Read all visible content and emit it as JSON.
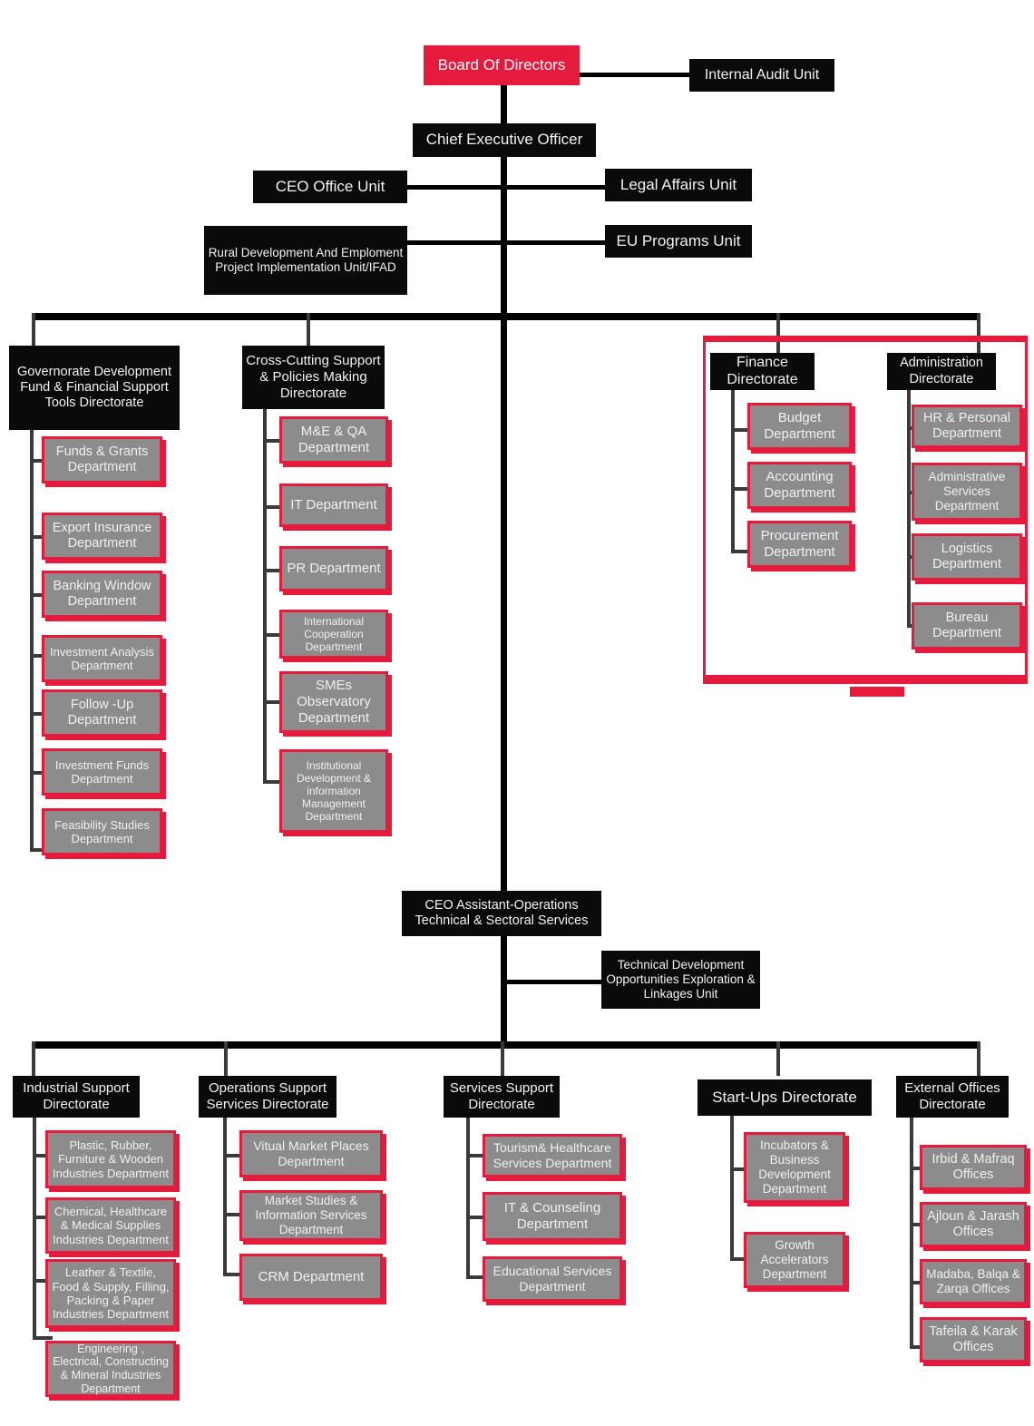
{
  "title": "Organizational Structure Chart",
  "colors": {
    "red": "#e51a3c",
    "black": "#0a0a0a",
    "gray": "#8c8c8c",
    "line": "#000000"
  },
  "top": {
    "board": "Board Of Directors",
    "internal_audit": "Internal Audit Unit",
    "ceo": "Chief Executive Officer",
    "ceo_office": "CEO Office Unit",
    "legal_affairs": "Legal Affairs Unit",
    "rural_dev": "Rural Development And Emploment Project Implementation Unit/IFAD",
    "eu_programs": "EU Programs Unit"
  },
  "directorates_upper": [
    {
      "name": "Governorate Development Fund & Financial Support Tools Directorate",
      "departments": [
        "Funds & Grants Department",
        "Export Insurance Department",
        "Banking Window Department",
        "Investment Analysis Department",
        "Follow -Up Department",
        "Investment Funds Department",
        "Feasibility Studies Department"
      ]
    },
    {
      "name": "Cross-Cutting Support & Policies Making Directorate",
      "departments": [
        "M&E & QA Department",
        "IT Department",
        "PR Department",
        "International Cooperation Department",
        "SMEs Observatory Department",
        "Institutional Development & information Management Department"
      ]
    },
    {
      "name": "Finance Directorate",
      "departments": [
        "Budget Department",
        "Accounting Department",
        "Procurement Department"
      ]
    },
    {
      "name": "Administration Directorate",
      "departments": [
        "HR & Personal Department",
        "Administrative Services Department",
        "Logistics Department",
        "Bureau Department"
      ]
    }
  ],
  "middle": {
    "ceo_assistant": "CEO Assistant-Operations Technical & Sectoral Services",
    "tech_dev_unit": "Technical Development Opportunities Exploration & Linkages Unit"
  },
  "directorates_lower": [
    {
      "name": "Industrial Support Directorate",
      "departments": [
        "Plastic, Rubber, Furniture & Wooden Industries Department",
        "Chemical, Healthcare & Medical Supplies Industries Department",
        "Leather & Textile, Food & Supply, Filling, Packing & Paper Industries Department",
        "Engineering , Electrical, Constructing & Mineral Industries Department"
      ]
    },
    {
      "name": "Operations Support Services Directorate",
      "departments": [
        "Vitual Market Places Department",
        "Market Studies & Information Services Department",
        "CRM Department"
      ]
    },
    {
      "name": "Services Support Directorate",
      "departments": [
        "Tourism& Healthcare Services Department",
        "IT & Counseling Department",
        "Educational Services Department"
      ]
    },
    {
      "name": "Start-Ups Directorate",
      "departments": [
        "Incubators & Business Development Department",
        "Growth Accelerators Department"
      ]
    },
    {
      "name": "External Offices Directorate",
      "departments": [
        "Irbid & Mafraq Offices",
        "Ajloun & Jarash Offices",
        "Madaba, Balqa & Zarqa Offices",
        "Tafeila & Karak Offices"
      ]
    }
  ]
}
